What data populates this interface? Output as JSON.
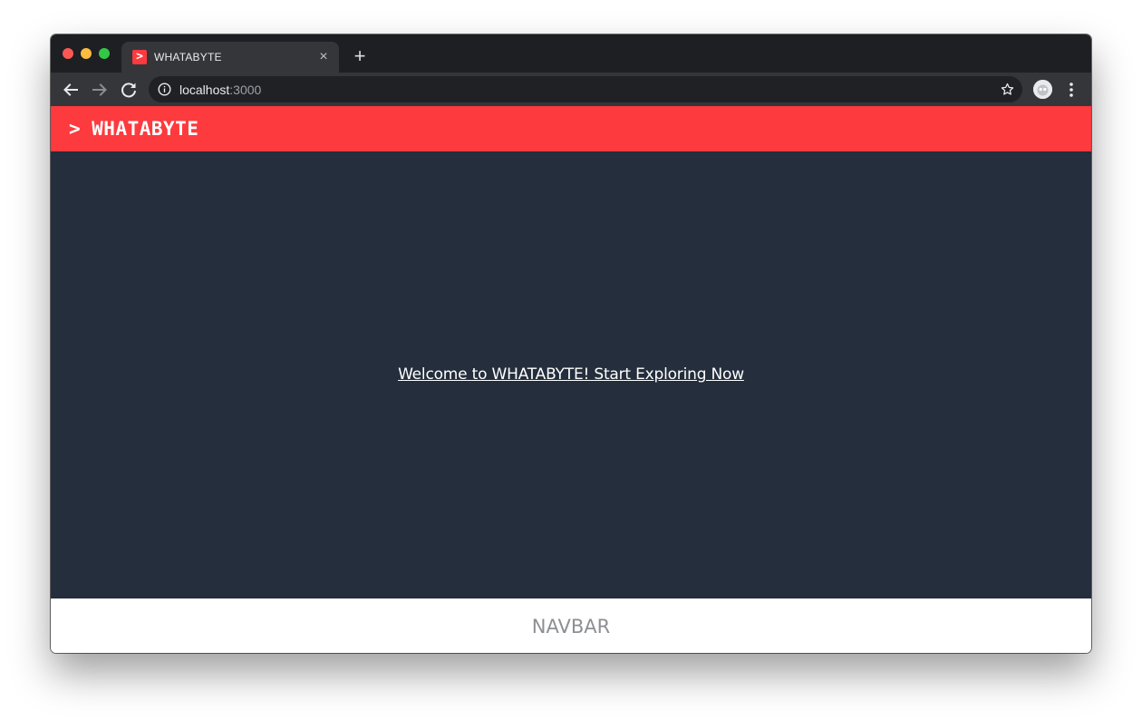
{
  "browser": {
    "tab": {
      "favicon_glyph": ">",
      "title": "WHATABYTE",
      "close_glyph": "×"
    },
    "new_tab_glyph": "+",
    "address_bar": {
      "host": "localhost",
      "port": ":3000"
    },
    "icons": [
      "back-arrow-icon",
      "forward-arrow-icon",
      "reload-icon",
      "info-icon",
      "star-icon",
      "profile-avatar-icon",
      "more-menu-icon"
    ]
  },
  "app": {
    "header": {
      "caret": ">",
      "brand": "WHATABYTE"
    },
    "main": {
      "welcome_link": "Welcome to WHATABYTE! Start Exploring Now"
    },
    "footer": {
      "navbar_label": "NAVBAR"
    }
  },
  "colors": {
    "brand_red": "#fd3a3e",
    "main_background": "#242e3c",
    "browser_chrome": "#35363a",
    "tabstrip": "#1e1f22"
  }
}
